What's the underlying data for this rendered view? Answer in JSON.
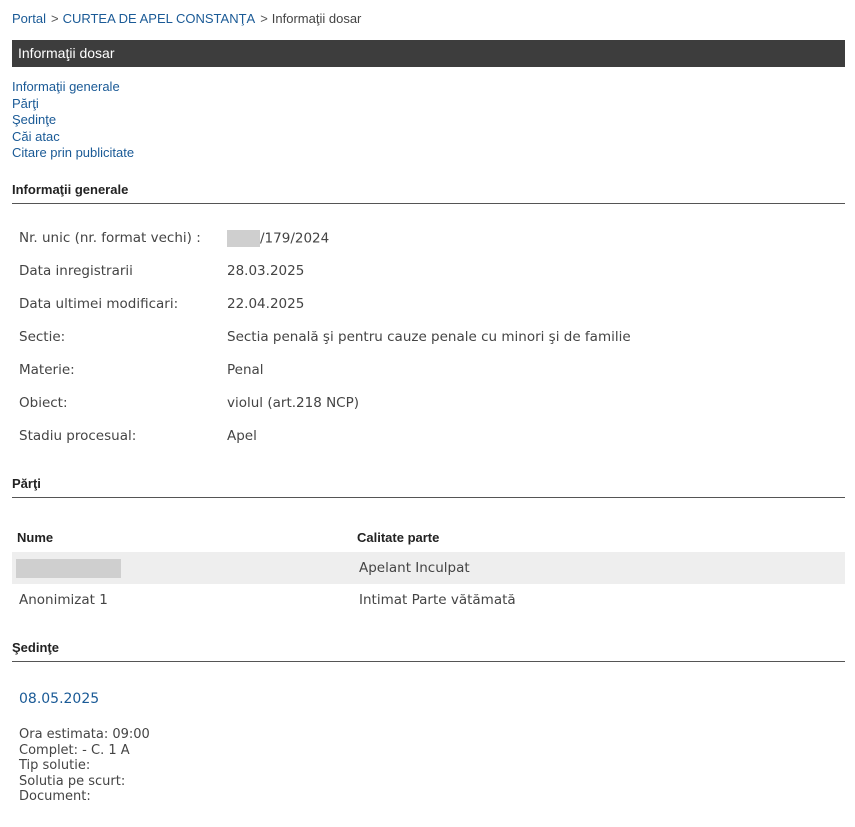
{
  "breadcrumb": {
    "portal": "Portal",
    "sep1": ">",
    "court": "CURTEA DE APEL CONSTANŢA",
    "sep2": ">",
    "current": "Informaţii dosar"
  },
  "titlebar": {
    "title": "Informaţii dosar"
  },
  "nav": {
    "items": [
      "Informaţii generale",
      "Părţi",
      "Şedinţe",
      "Căi atac",
      "Citare prin publicitate"
    ]
  },
  "general": {
    "heading": "Informaţii generale",
    "rows": [
      {
        "label": "Nr. unic (nr. format vechi) :",
        "value": "/179/2024"
      },
      {
        "label": "Data inregistrarii",
        "value": "28.03.2025"
      },
      {
        "label": "Data ultimei modificari:",
        "value": "22.04.2025"
      },
      {
        "label": "Sectie:",
        "value": "Sectia penală şi pentru cauze penale cu minori şi de familie"
      },
      {
        "label": "Materie:",
        "value": "Penal"
      },
      {
        "label": "Obiect:",
        "value": "violul (art.218 NCP)"
      },
      {
        "label": "Stadiu procesual:",
        "value": "Apel"
      }
    ]
  },
  "parties": {
    "heading": "Părţi",
    "columns": [
      "Nume",
      "Calitate parte"
    ],
    "rows": [
      {
        "name": "",
        "role": "Apelant Inculpat"
      },
      {
        "name": "Anonimizat 1",
        "role": "Intimat Parte vătămată"
      }
    ]
  },
  "hearings": {
    "heading": "Şedinţe",
    "date": "08.05.2025",
    "details": [
      "Ora estimata: 09:00",
      "Complet: - C. 1 A",
      "Tip solutie:",
      "Solutia pe scurt:",
      "Document:"
    ]
  },
  "colors": {
    "link": "#1a5a96",
    "titlebar_bg": "#3d3d3d",
    "alt_row_bg": "#eeeeee",
    "redaction": "#cfcfcf"
  }
}
